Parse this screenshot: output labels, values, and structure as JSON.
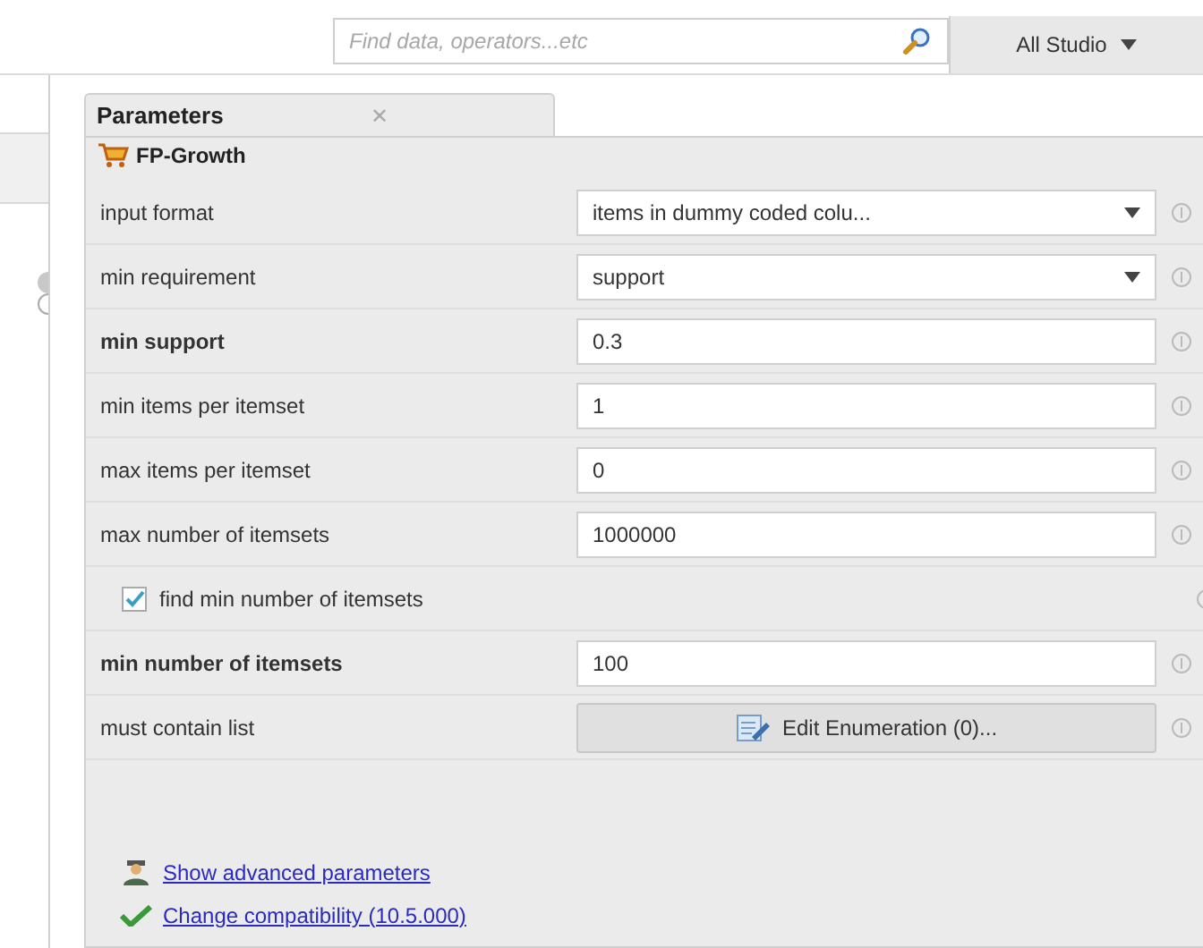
{
  "search": {
    "placeholder": "Find data, operators...etc"
  },
  "scope_button": {
    "label": "All Studio"
  },
  "panel_tab": {
    "title": "Parameters",
    "close": "✕"
  },
  "operator": {
    "name": "FP-Growth"
  },
  "parameters": [
    {
      "kind": "select",
      "label": "input format",
      "value": "items in dummy coded colu...",
      "bold": false
    },
    {
      "kind": "select",
      "label": "min requirement",
      "value": "support",
      "bold": false
    },
    {
      "kind": "text",
      "label": "min support",
      "value": "0.3",
      "bold": true
    },
    {
      "kind": "text",
      "label": "min items per itemset",
      "value": "1",
      "bold": false
    },
    {
      "kind": "text",
      "label": "max items per itemset",
      "value": "0",
      "bold": false
    },
    {
      "kind": "text",
      "label": "max number of itemsets",
      "value": "1000000",
      "bold": false
    },
    {
      "kind": "checkbox",
      "label": "find min number of itemsets",
      "checked": true
    },
    {
      "kind": "text",
      "label": "min number of itemsets",
      "value": "100",
      "bold": true
    },
    {
      "kind": "button",
      "label": "must contain list",
      "value": "Edit Enumeration (0)...",
      "bold": false
    }
  ],
  "links": [
    {
      "kind": "advanced",
      "label": "Show advanced parameters"
    },
    {
      "kind": "compat",
      "label": "Change compatibility (10.5.000)"
    }
  ]
}
